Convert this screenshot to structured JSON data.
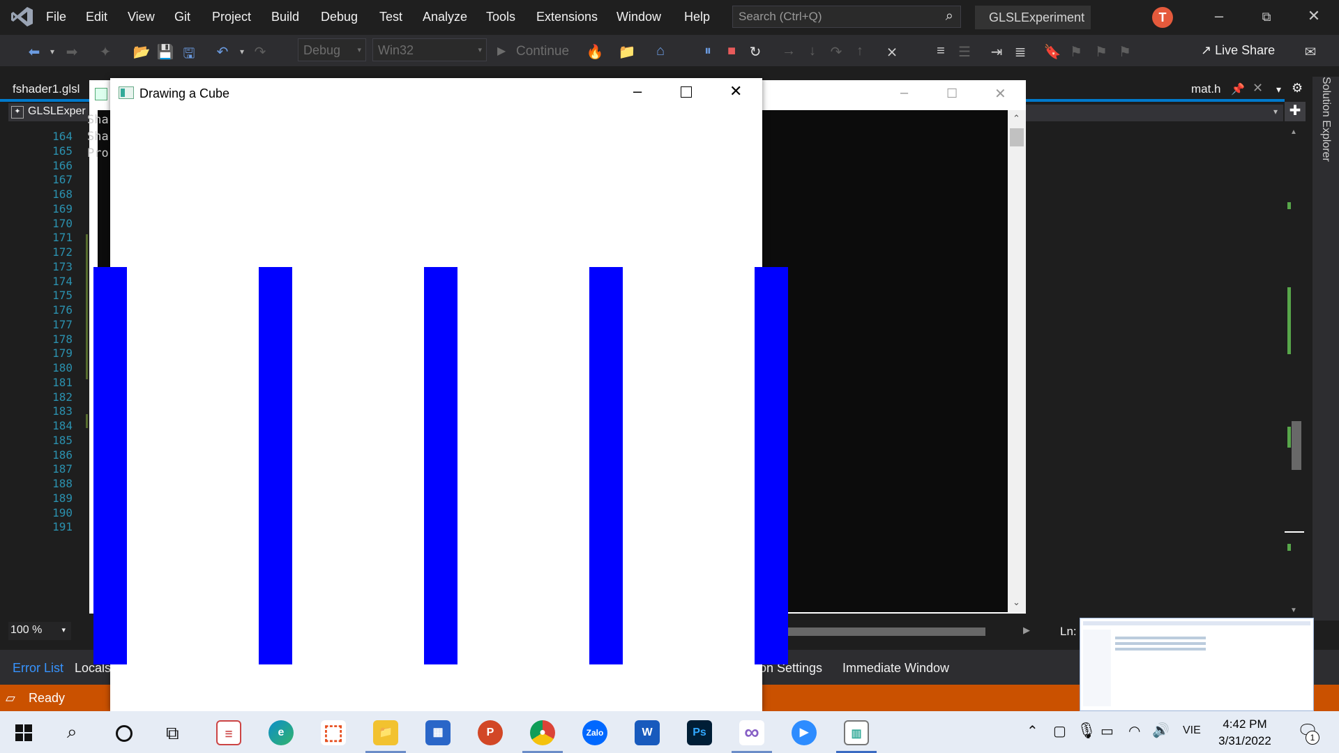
{
  "vs": {
    "menu": [
      "File",
      "Edit",
      "View",
      "Git",
      "Project",
      "Build",
      "Debug",
      "Test",
      "Analyze",
      "Tools",
      "Extensions",
      "Window",
      "Help"
    ],
    "search_placeholder": "Search (Ctrl+Q)",
    "project_name": "GLSLExperiment",
    "user_initial": "T",
    "toolbar": {
      "config": "Debug",
      "platform": "Win32",
      "continue_label": "Continue",
      "live_share_label": "Live Share"
    },
    "tabs": {
      "left_doc": "fshader1.glsl",
      "right_doc": "mat.h",
      "nav_project": "GLSLExper"
    },
    "line_numbers": [
      "164",
      "165",
      "166",
      "167",
      "168",
      "169",
      "170",
      "171",
      "172",
      "173",
      "174",
      "175",
      "176",
      "177",
      "178",
      "179",
      "180",
      "181",
      "182",
      "183",
      "184",
      "185",
      "186",
      "187",
      "188",
      "189",
      "190",
      "191"
    ],
    "zoom": "100 %",
    "ln_label": "Ln:",
    "bottom_tabs": {
      "error_list": "Error List",
      "locals": "Locals",
      "solution_settings": "ion Settings",
      "immediate": "Immediate Window"
    },
    "status": "Ready",
    "solution_explorer": "Solution Explorer"
  },
  "console": {
    "lines": [
      "Sha",
      "Sha",
      "Pro"
    ]
  },
  "glwindow": {
    "title": "Drawing a Cube",
    "bar_color": "#0000ff"
  },
  "taskbar": {
    "time": "4:42 PM",
    "date": "3/31/2022",
    "language": "VIE",
    "notifications": "1",
    "apps": [
      "Zalo",
      "W",
      "Ps",
      "P"
    ]
  },
  "colors": {
    "accent": "#007acc",
    "status_bar": "#ca5100"
  }
}
